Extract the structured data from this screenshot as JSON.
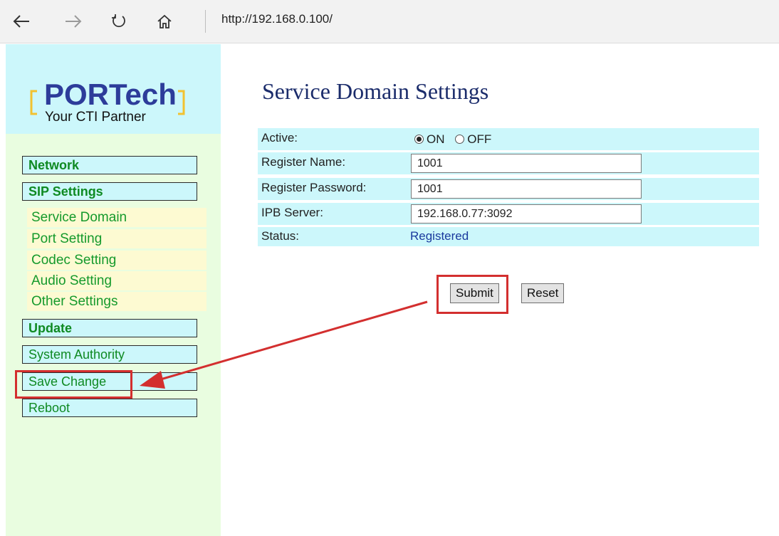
{
  "browser": {
    "url": "http://192.168.0.100/",
    "icons": [
      "back-arrow-icon",
      "forward-arrow-icon",
      "refresh-icon",
      "home-icon"
    ]
  },
  "logo": {
    "brand": "PORTech",
    "tagline": "Your CTI Partner"
  },
  "sidebar": {
    "items": [
      {
        "label": "Network"
      },
      {
        "label": "SIP Settings"
      },
      {
        "label": "Service Domain"
      },
      {
        "label": "Port Setting"
      },
      {
        "label": "Codec Setting"
      },
      {
        "label": "Audio Setting"
      },
      {
        "label": "Other Settings"
      },
      {
        "label": "Update"
      },
      {
        "label": "System Authority"
      },
      {
        "label": "Save Change"
      },
      {
        "label": "Reboot"
      }
    ]
  },
  "main": {
    "title": "Service Domain Settings",
    "active": {
      "label": "Active:",
      "on_label": "ON",
      "off_label": "OFF",
      "selected": "ON"
    },
    "register_name": {
      "label": "Register Name:",
      "value": "1001"
    },
    "register_password": {
      "label": "Register Password:",
      "value": "1001"
    },
    "ipb_server": {
      "label": "IPB Server:",
      "value": "192.168.0.77:3092"
    },
    "status": {
      "label": "Status:",
      "value": "Registered"
    },
    "submit_label": "Submit",
    "reset_label": "Reset"
  },
  "colors": {
    "highlight": "#d32f2f",
    "sidebar_bg": "#e9fde0",
    "logo_bg": "#ccf7fb",
    "row_bg": "#ccf7fb",
    "link_green": "#0f8a22",
    "title_blue": "#1b2c6b",
    "status_blue": "#1a3a9e"
  }
}
